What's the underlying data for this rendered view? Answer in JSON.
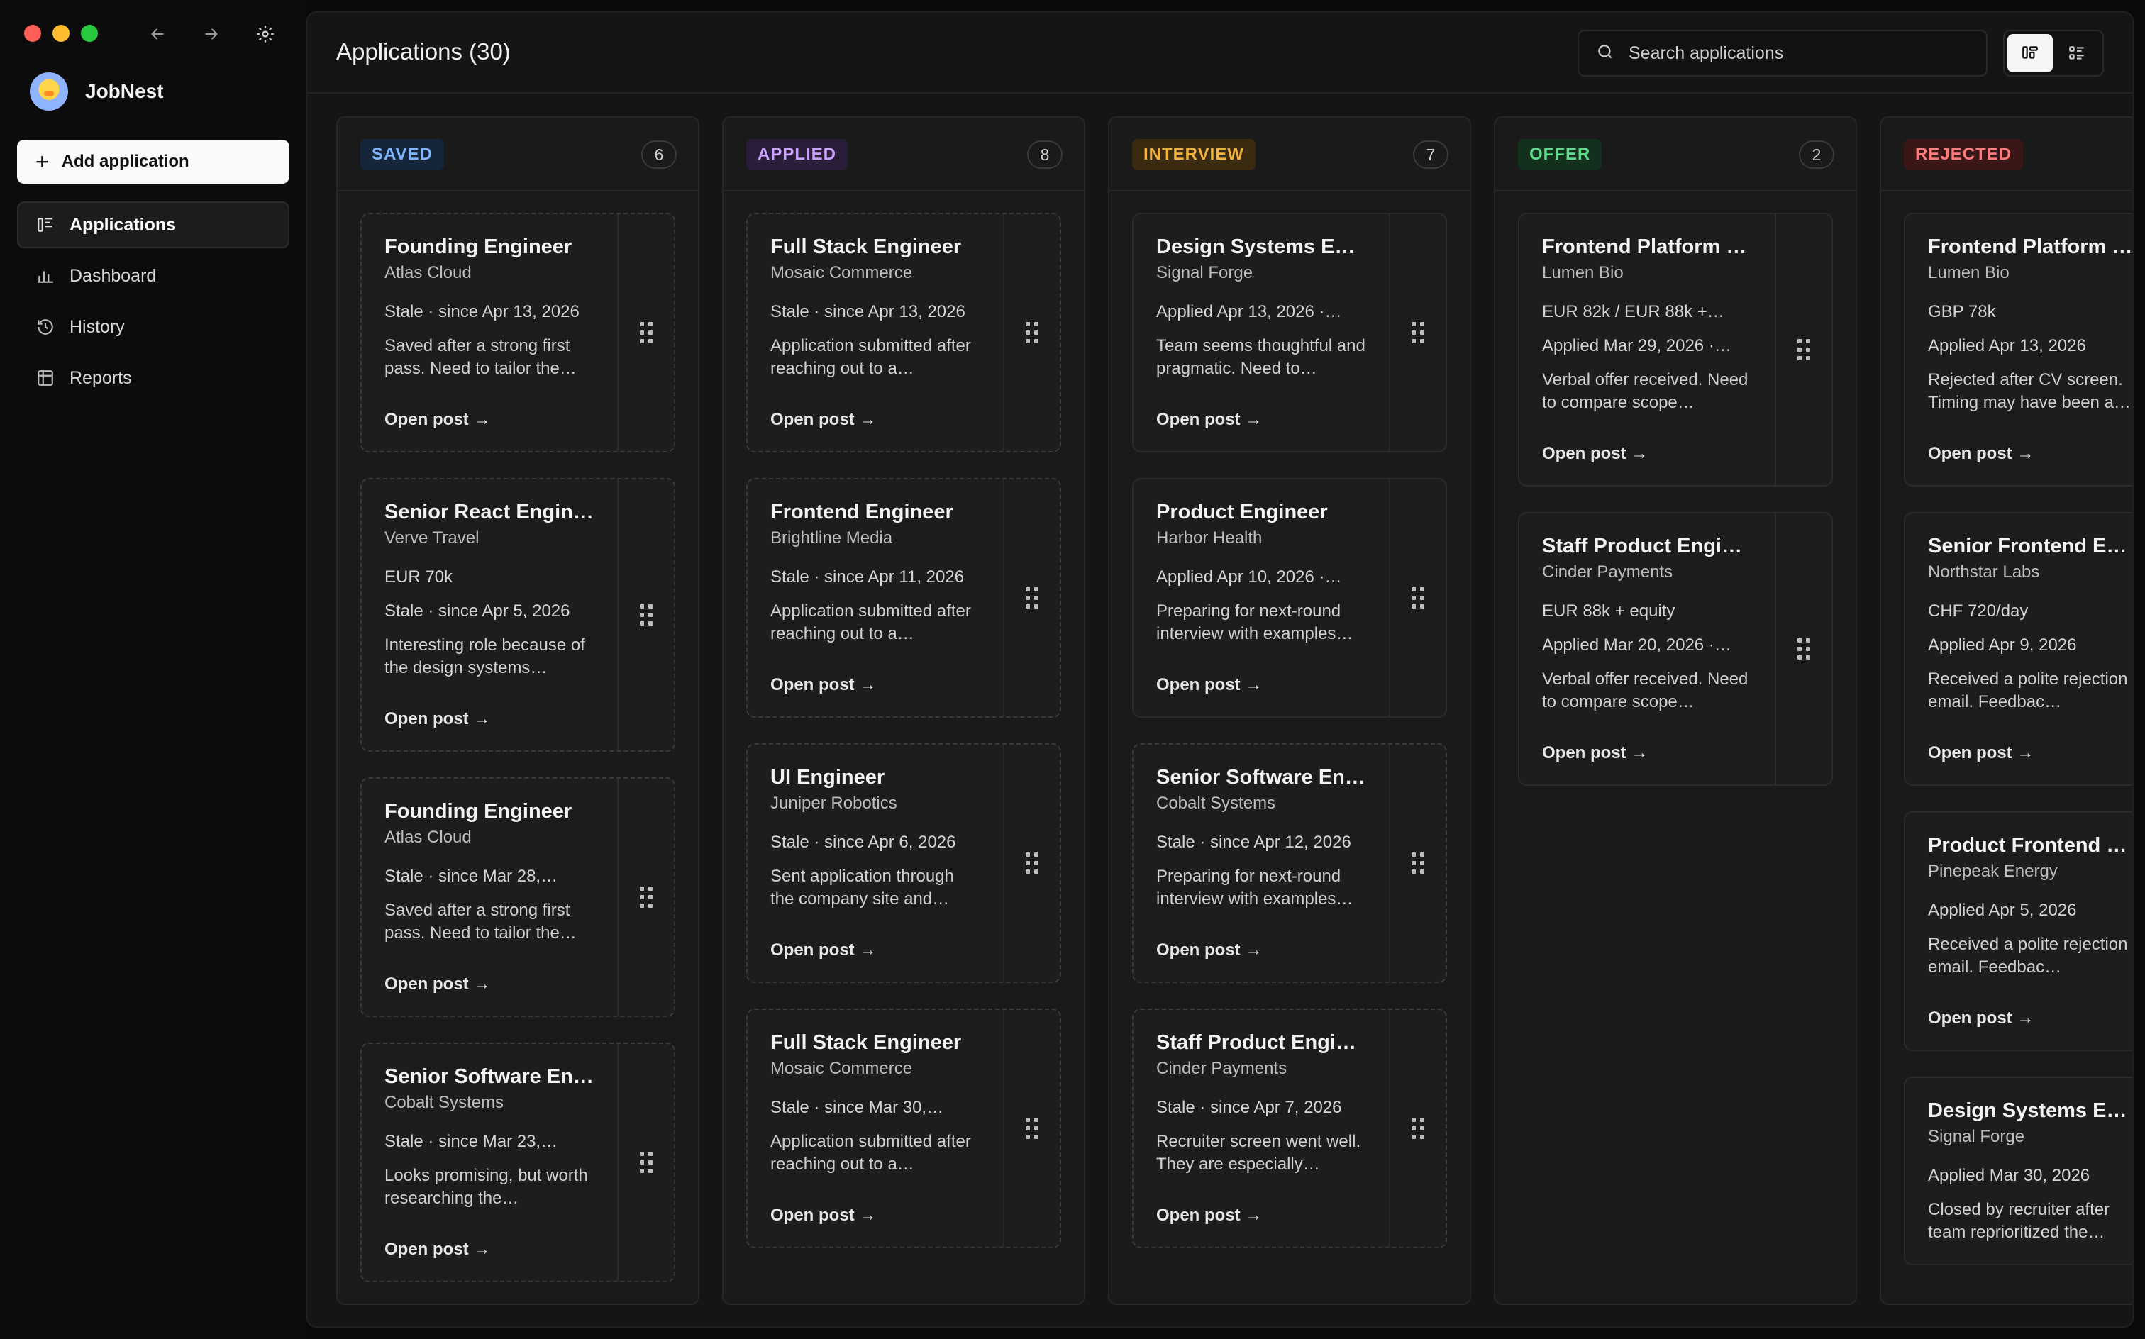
{
  "app": {
    "name": "JobNest"
  },
  "sidebar": {
    "add_label": "Add application",
    "items": [
      {
        "label": "Applications",
        "icon": "kanban-icon",
        "active": true
      },
      {
        "label": "Dashboard",
        "icon": "bar-chart-icon",
        "active": false
      },
      {
        "label": "History",
        "icon": "history-icon",
        "active": false
      },
      {
        "label": "Reports",
        "icon": "table-icon",
        "active": false
      }
    ]
  },
  "header": {
    "title": "Applications (30)",
    "search_placeholder": "Search applications",
    "view_modes": [
      "board-view-icon",
      "list-view-icon"
    ]
  },
  "columns": [
    {
      "label": "SAVED",
      "count": "6",
      "badge_bg": "#16263a",
      "badge_fg": "#7fb4ff",
      "dashed": true,
      "cards": [
        {
          "title": "Founding Engineer",
          "company": "Atlas Cloud",
          "status": "Stale · since Apr 13, 2026",
          "note": "Saved after a strong first pass. Need to tailor the…",
          "link": "Open post →"
        },
        {
          "title": "Senior React Engine…",
          "company": "Verve Travel",
          "salary": "EUR 70k",
          "status": "Stale · since Apr 5, 2026",
          "note": "Interesting role because of the design systems…",
          "link": "Open post →"
        },
        {
          "title": "Founding Engineer",
          "company": "Atlas Cloud",
          "status": "Stale · since Mar 28,…",
          "note": "Saved after a strong first pass. Need to tailor the…",
          "link": "Open post →"
        },
        {
          "title": "Senior Software En…",
          "company": "Cobalt Systems",
          "status": "Stale · since Mar 23,…",
          "note": "Looks promising, but worth researching the…",
          "link": "Open post →"
        }
      ]
    },
    {
      "label": "APPLIED",
      "count": "8",
      "badge_bg": "#2a1d3a",
      "badge_fg": "#c9a2ff",
      "dashed": true,
      "cards": [
        {
          "title": "Full Stack Engineer",
          "company": "Mosaic Commerce",
          "status": "Stale · since Apr 13, 2026",
          "note": "Application submitted after reaching out to a…",
          "link": "Open post →"
        },
        {
          "title": "Frontend Engineer",
          "company": "Brightline Media",
          "status": "Stale · since Apr 11, 2026",
          "note": "Application submitted after reaching out to a…",
          "link": "Open post →"
        },
        {
          "title": "UI Engineer",
          "company": "Juniper Robotics",
          "status": "Stale · since Apr 6, 2026",
          "note": "Sent application through the company site and…",
          "link": "Open post →"
        },
        {
          "title": "Full Stack Engineer",
          "company": "Mosaic Commerce",
          "status": "Stale · since Mar 30,…",
          "note": "Application submitted after reaching out to a…",
          "link": "Open post →"
        }
      ]
    },
    {
      "label": "INTERVIEW",
      "count": "7",
      "badge_bg": "#3a2a0f",
      "badge_fg": "#f0b23a",
      "dashed": false,
      "cards": [
        {
          "title": "Design Systems En…",
          "company": "Signal Forge",
          "status": "Applied Apr 13, 2026 ·…",
          "note": "Team seems thoughtful and pragmatic. Need to…",
          "link": "Open post →",
          "dashed": false
        },
        {
          "title": "Product Engineer",
          "company": "Harbor Health",
          "status": "Applied Apr 10, 2026 ·…",
          "note": "Preparing for next-round interview with examples…",
          "link": "Open post →",
          "dashed": false
        },
        {
          "title": "Senior Software En…",
          "company": "Cobalt Systems",
          "status": "Stale · since Apr 12, 2026",
          "note": "Preparing for next-round interview with examples…",
          "link": "Open post →",
          "dashed": true
        },
        {
          "title": "Staff Product Engin…",
          "company": "Cinder Payments",
          "status": "Stale · since Apr 7, 2026",
          "note": "Recruiter screen went well. They are especially…",
          "link": "Open post →",
          "dashed": true
        }
      ]
    },
    {
      "label": "OFFER",
      "count": "2",
      "badge_bg": "#12301c",
      "badge_fg": "#5fd98a",
      "dashed": false,
      "cards": [
        {
          "title": "Frontend Platform E…",
          "company": "Lumen Bio",
          "salary": "EUR 82k / EUR 88k +…",
          "status": "Applied Mar 29, 2026 ·…",
          "note": "Verbal offer received. Need to compare scope…",
          "link": "Open post →"
        },
        {
          "title": "Staff Product Engin…",
          "company": "Cinder Payments",
          "salary": "EUR 88k + equity",
          "status": "Applied Mar 20, 2026 ·…",
          "note": "Verbal offer received. Need to compare scope…",
          "link": "Open post →"
        }
      ]
    },
    {
      "label": "REJECTED",
      "count": "",
      "badge_bg": "#3a1616",
      "badge_fg": "#ff7a7a",
      "dashed": false,
      "cards": [
        {
          "title": "Frontend Platform E…",
          "company": "Lumen Bio",
          "salary": "GBP 78k",
          "status": "Applied Apr 13, 2026",
          "note": "Rejected after CV screen. Timing may have been a…",
          "link": "Open post →"
        },
        {
          "title": "Senior Frontend En…",
          "company": "Northstar Labs",
          "salary": "CHF 720/day",
          "status": "Applied Apr 9, 2026",
          "note": "Received a polite rejection email. Feedbac…",
          "link": "Open post →"
        },
        {
          "title": "Product Frontend E…",
          "company": "Pinepeak Energy",
          "status": "Applied Apr 5, 2026",
          "note": "Received a polite rejection email. Feedbac…",
          "link": "Open post →"
        },
        {
          "title": "Design Systems En…",
          "company": "Signal Forge",
          "status": "Applied Mar 30, 2026",
          "note": "Closed by recruiter after team reprioritized the…",
          "link": ""
        }
      ]
    }
  ]
}
